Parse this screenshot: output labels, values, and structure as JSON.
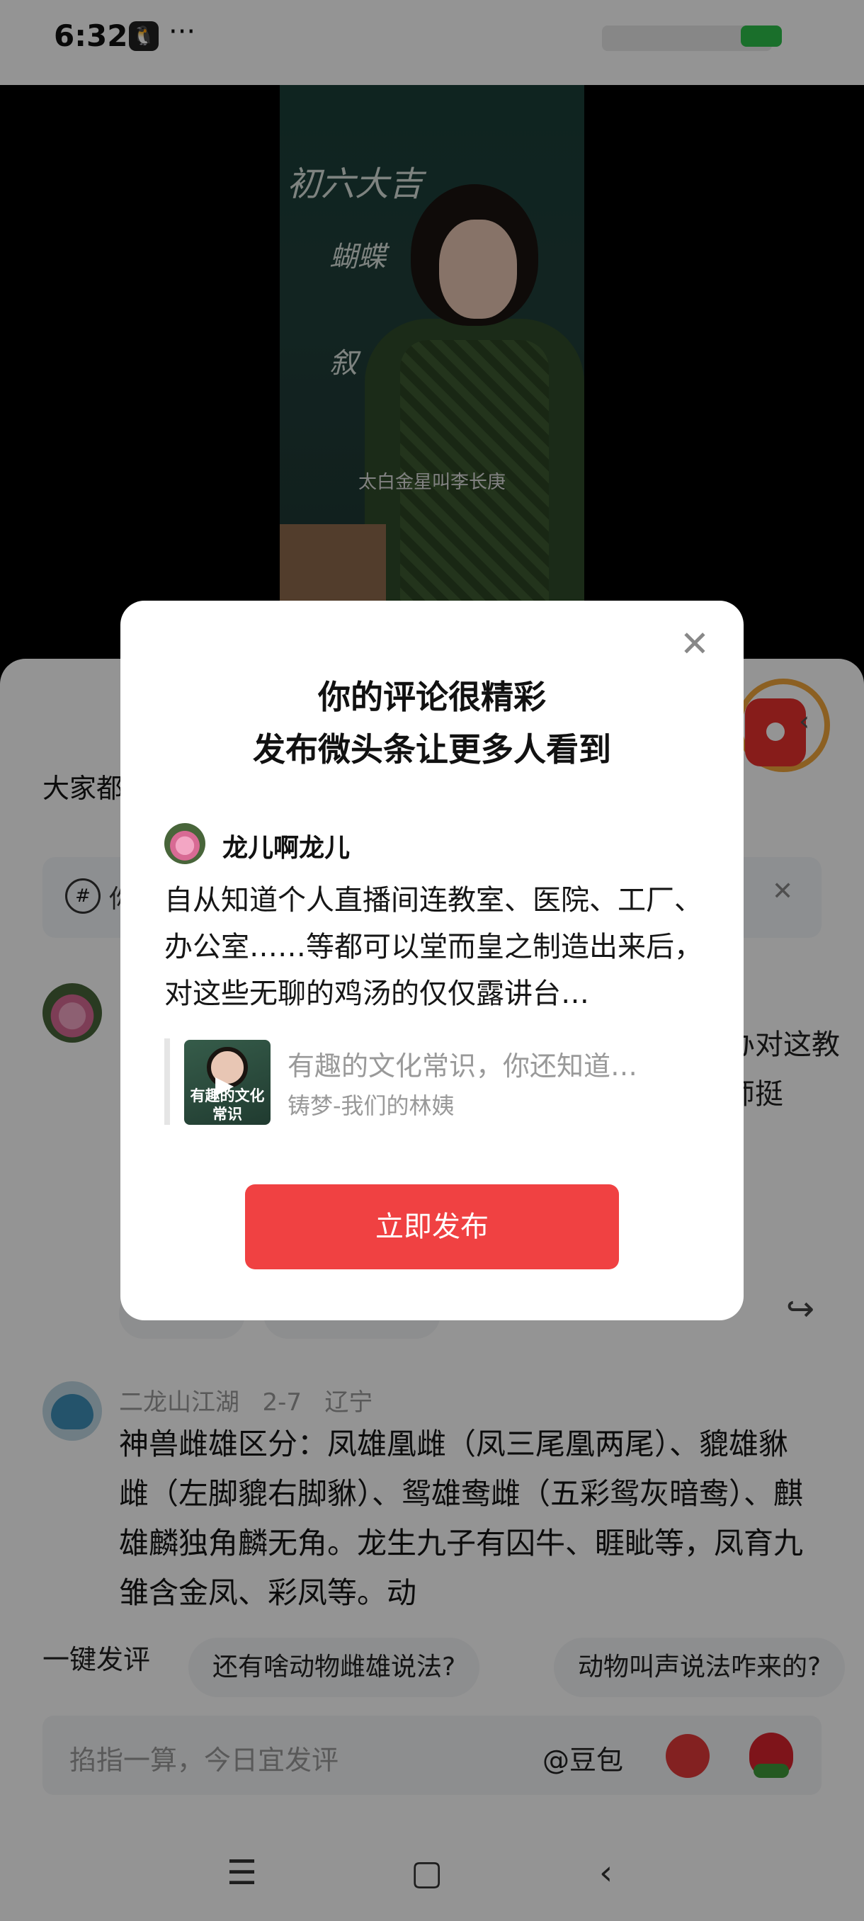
{
  "status_bar": {
    "time": "6:32",
    "more": "···"
  },
  "video": {
    "board_line1": "初六大吉",
    "board_line2": "蝴蝶",
    "board_line3": "叙",
    "subtitle": "太白金星叫李长庚"
  },
  "sheet": {
    "everyone_text": "大家都",
    "banner_text": "你",
    "comment1_text": "、办对这教室师挺",
    "comment2": {
      "username": "二龙山江湖",
      "date": "2-7",
      "location": "辽宁",
      "body": "神兽雌雄区分：凤雄凰雌（凤三尾凰两尾）、貔雄貅雌（左脚貔右脚貅）、鸳雄鸯雌（五彩鸳灰暗鸯）、麒雄麟独角麟无角。龙生九子有囚牛、睚眦等，凤育九雏含金凤、彩凤等。动"
    },
    "quick_comment": {
      "label": "一键发评",
      "chips": [
        "还有啥动物雌雄说法?",
        "动物叫声说法咋来的?"
      ]
    },
    "input": {
      "placeholder": "掐指一算，今日宜发评",
      "mention": "@豆包"
    }
  },
  "modal": {
    "title_line1": "你的评论很精彩",
    "title_line2": "发布微头条让更多人看到",
    "username": "龙儿啊龙儿",
    "body": "自从知道个人直播间连教室、医院、工厂、办公室……等都可以堂而皇之制造出来后，对这些无聊的鸡汤的仅仅露讲台…",
    "link_thumb_text": "有趣的文化常识",
    "link_title": "有趣的文化常识，你还知道…",
    "link_author": "铸梦-我们的林姨",
    "publish_button": "立即发布"
  },
  "colors": {
    "accent": "#f04142",
    "battery": "#2ec04a"
  },
  "icons": [
    "qq-icon",
    "close-icon",
    "share-icon",
    "menu-icon",
    "home-icon",
    "back-icon",
    "comment-icon",
    "play-icon"
  ]
}
